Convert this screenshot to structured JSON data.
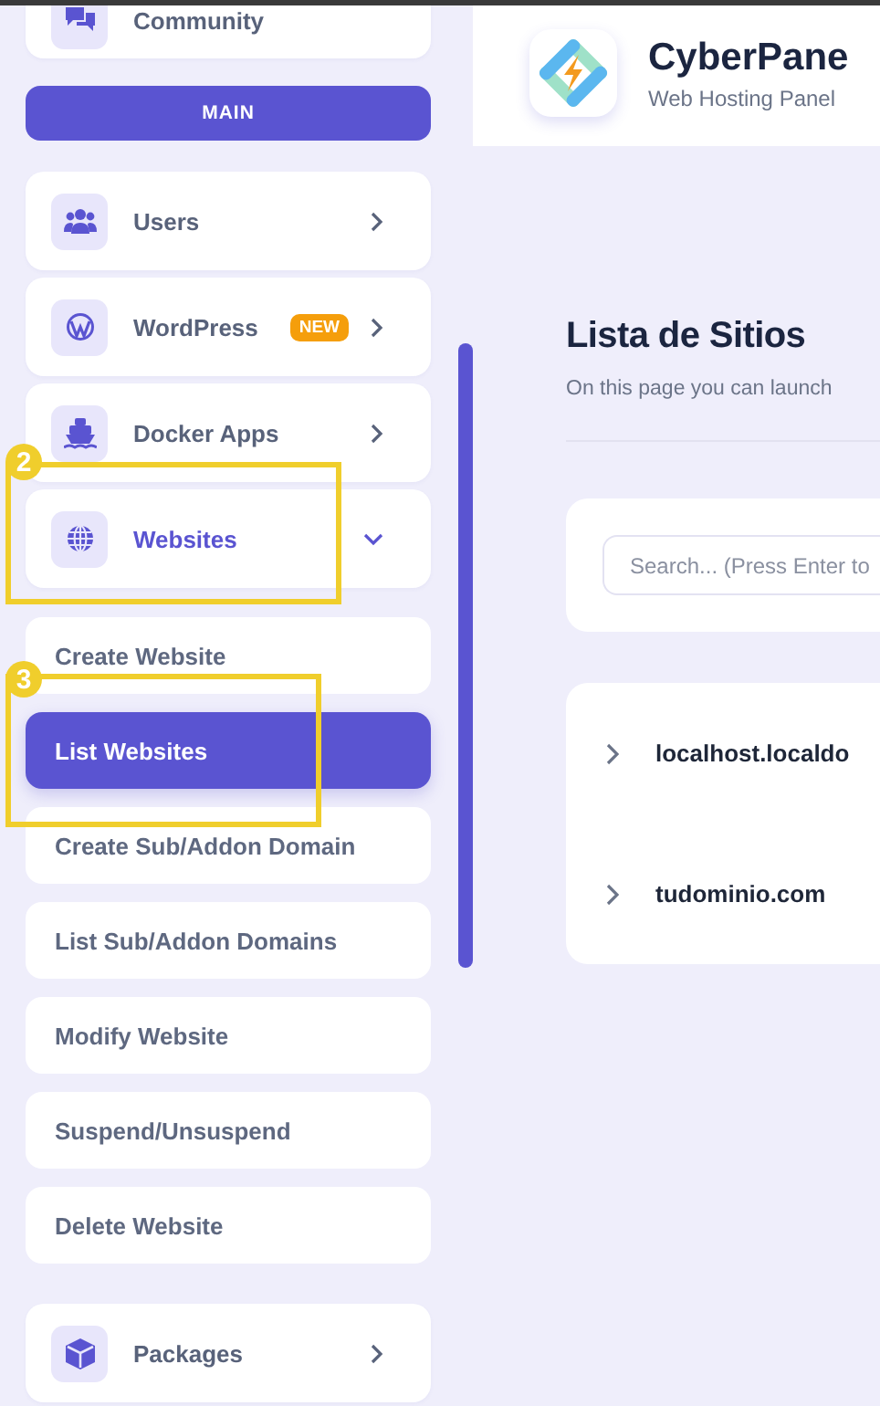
{
  "sidebar": {
    "community": {
      "label": "Community"
    },
    "section_header": "MAIN",
    "menu": [
      {
        "label": "Users",
        "expanded": false
      },
      {
        "label": "WordPress",
        "badge": "NEW",
        "expanded": false
      },
      {
        "label": "Docker Apps",
        "expanded": false
      },
      {
        "label": "Websites",
        "expanded": true,
        "children": [
          {
            "label": "Create Website",
            "selected": false
          },
          {
            "label": "List Websites",
            "selected": true
          },
          {
            "label": "Create Sub/Addon Domain",
            "selected": false
          },
          {
            "label": "List Sub/Addon Domains",
            "selected": false
          },
          {
            "label": "Modify Website",
            "selected": false
          },
          {
            "label": "Suspend/Unsuspend",
            "selected": false
          },
          {
            "label": "Delete Website",
            "selected": false
          }
        ]
      },
      {
        "label": "Packages",
        "expanded": false
      }
    ]
  },
  "annotations": [
    {
      "number": "2"
    },
    {
      "number": "3"
    }
  ],
  "header": {
    "title": "CyberPane",
    "subtitle": "Web Hosting Panel"
  },
  "page": {
    "title": "Lista de Sitios",
    "description": "On this page you can launch"
  },
  "search": {
    "placeholder": "Search... (Press Enter to"
  },
  "sites": [
    {
      "name": "localhost.localdo"
    },
    {
      "name": "tudominio.com"
    }
  ]
}
